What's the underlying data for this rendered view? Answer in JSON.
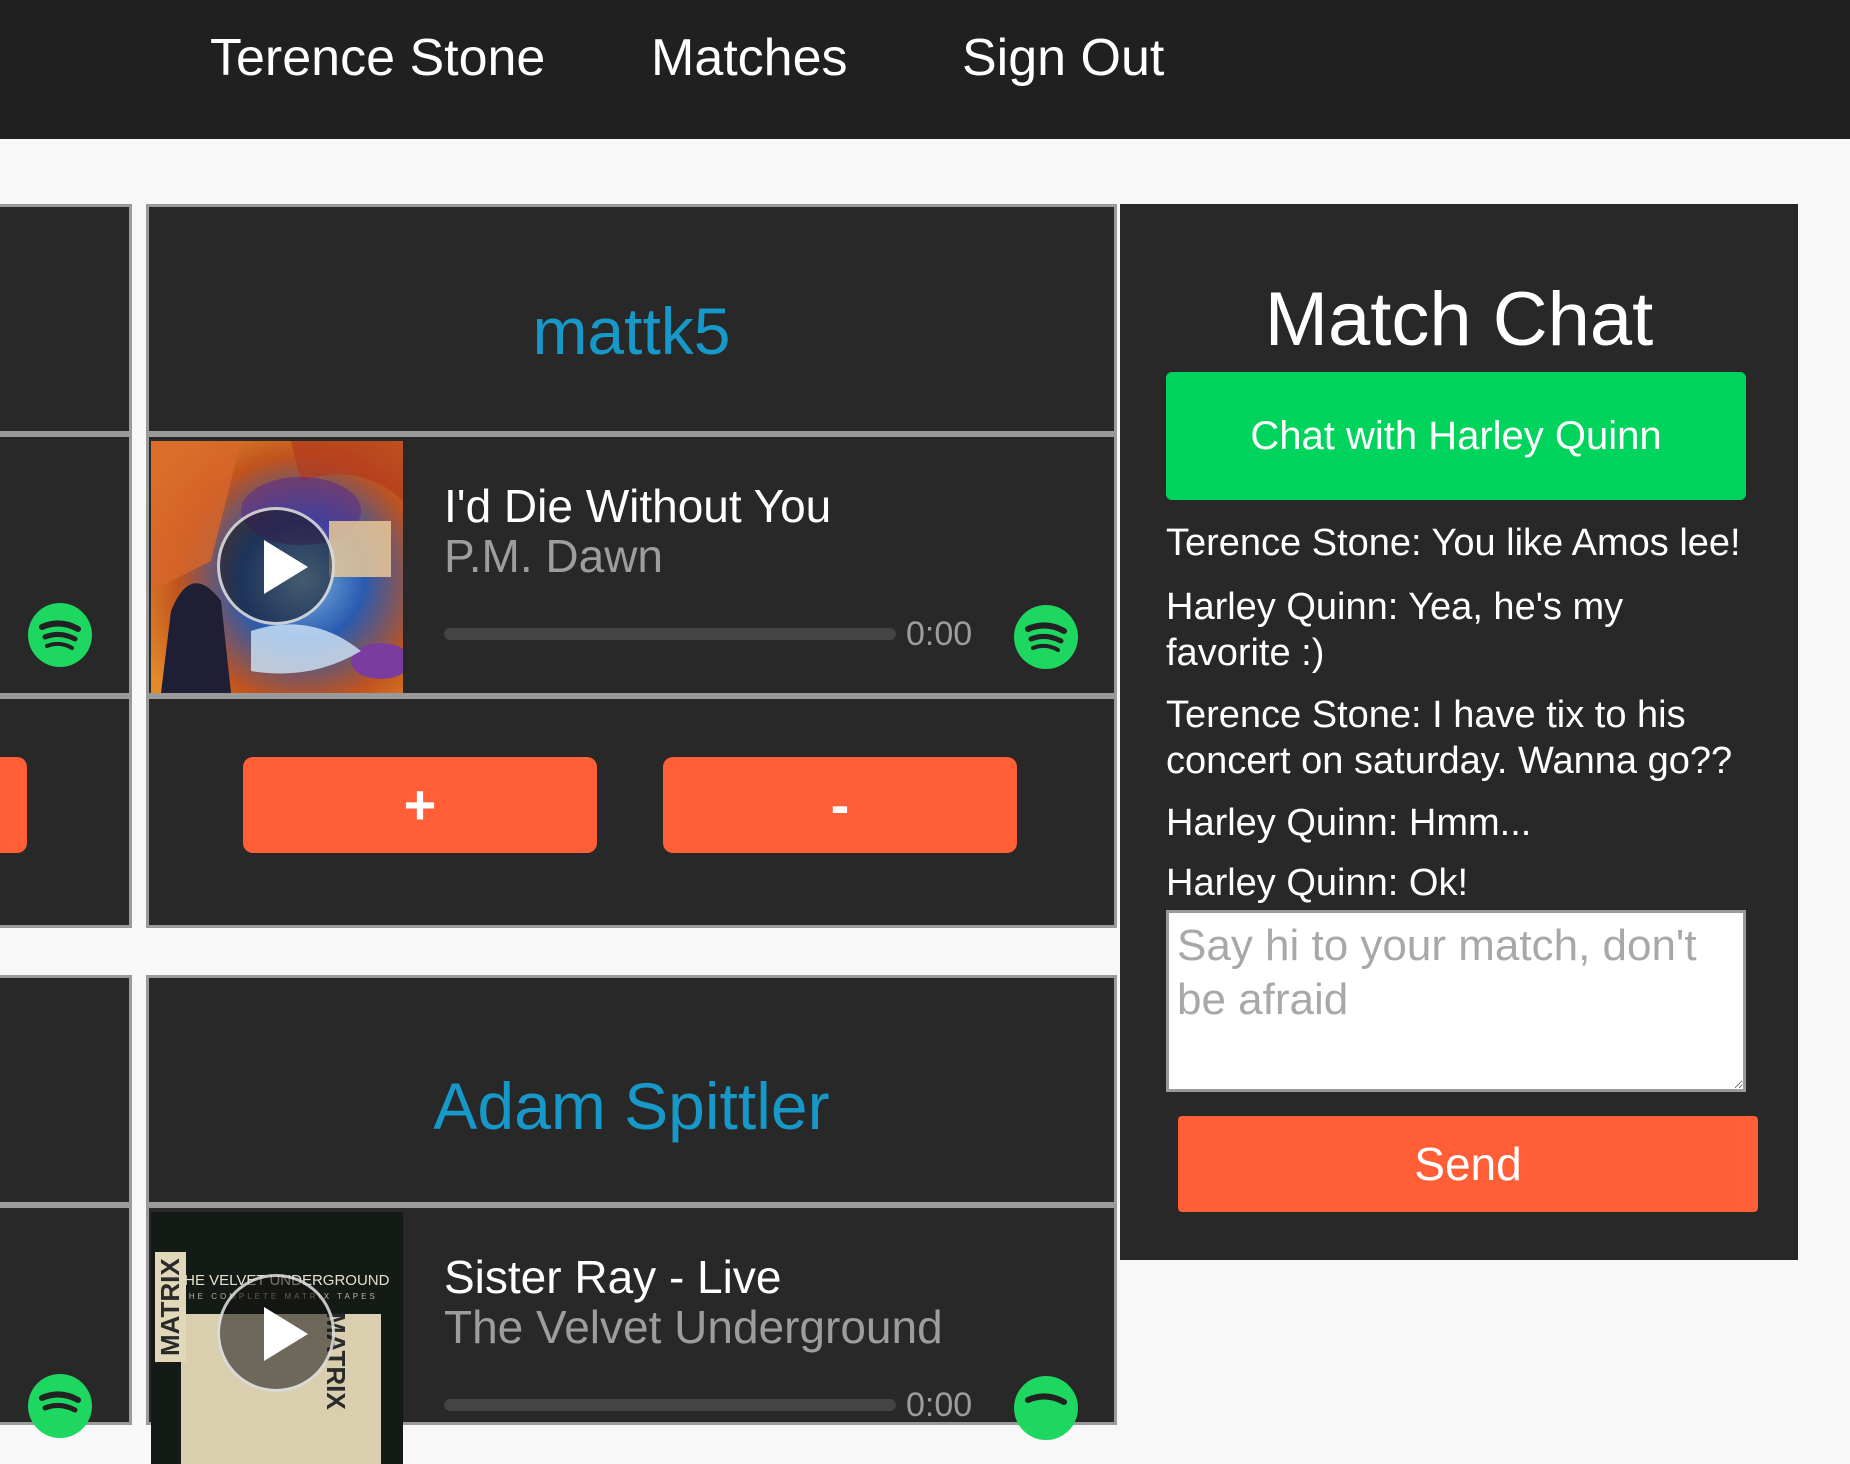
{
  "nav": {
    "user_name": "Terence Stone",
    "matches": "Matches",
    "sign_out": "Sign Out"
  },
  "cards": [
    {
      "username": "mattk5",
      "track": {
        "title": "I'd Die Without You",
        "artist": "P.M. Dawn",
        "time": "0:00",
        "progress": 0
      },
      "upvote_label": "+",
      "downvote_label": "-"
    },
    {
      "username": "Adam Spittler",
      "track": {
        "title": "Sister Ray - Live",
        "artist": "The Velvet Underground",
        "time": "0:00",
        "progress": 0,
        "album_text": "THE VELVET UNDERGROUND",
        "album_subtext": "THE COMPLETE MATRIX TAPES",
        "album_side_text": "MATRIX"
      }
    }
  ],
  "chat": {
    "title": "Match Chat",
    "chat_with_label": "Chat with Harley Quinn",
    "messages": [
      "Terence Stone: You like Amos lee!",
      "Harley Quinn: Yea, he's my favorite :)",
      "Terence Stone: I have tix to his concert on saturday. Wanna go??",
      "Harley Quinn: Hmm...",
      "Harley Quinn: Ok!"
    ],
    "input_placeholder": "Say hi to your match, don't be afraid",
    "send_label": "Send"
  },
  "colors": {
    "nav_bg": "#202020",
    "panel_bg": "#282828",
    "accent_orange": "#ff5e36",
    "accent_green": "#00d45c",
    "username_blue": "#1698c8",
    "spotify_green": "#1ed760"
  },
  "icons": {
    "play": "play-icon",
    "spotify": "spotify-icon",
    "resize": "resize-handle-icon"
  }
}
